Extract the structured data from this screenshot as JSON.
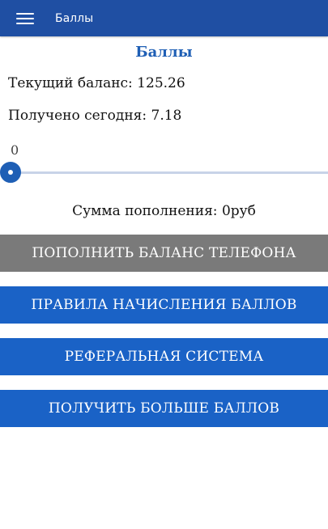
{
  "header": {
    "title": "Баллы",
    "menu_icon": "hamburger-menu-icon",
    "background": "#1f4fa3"
  },
  "main": {
    "title": "Баллы",
    "balance_text": "Текущий баланс: 125.26",
    "today_text": "Получено сегодня: 7.18",
    "slider": {
      "value_label": "0",
      "value": 0
    },
    "topup_sum_text": "Сумма пополнения: 0руб"
  },
  "buttons": {
    "topup_phone": "ПОПОЛНИТЬ БАЛАНС ТЕЛЕФОНА",
    "rules": "ПРАВИЛА НАЧИСЛЕНИЯ БАЛЛОВ",
    "referral": "РЕФЕРАЛЬНАЯ СИСТЕМА",
    "get_more": "ПОЛУЧИТЬ БОЛЬШЕ БАЛЛОВ"
  },
  "colors": {
    "accent": "#1a62c6",
    "disabled_button": "#7a7a7a",
    "title_text": "#1f5fb5"
  }
}
